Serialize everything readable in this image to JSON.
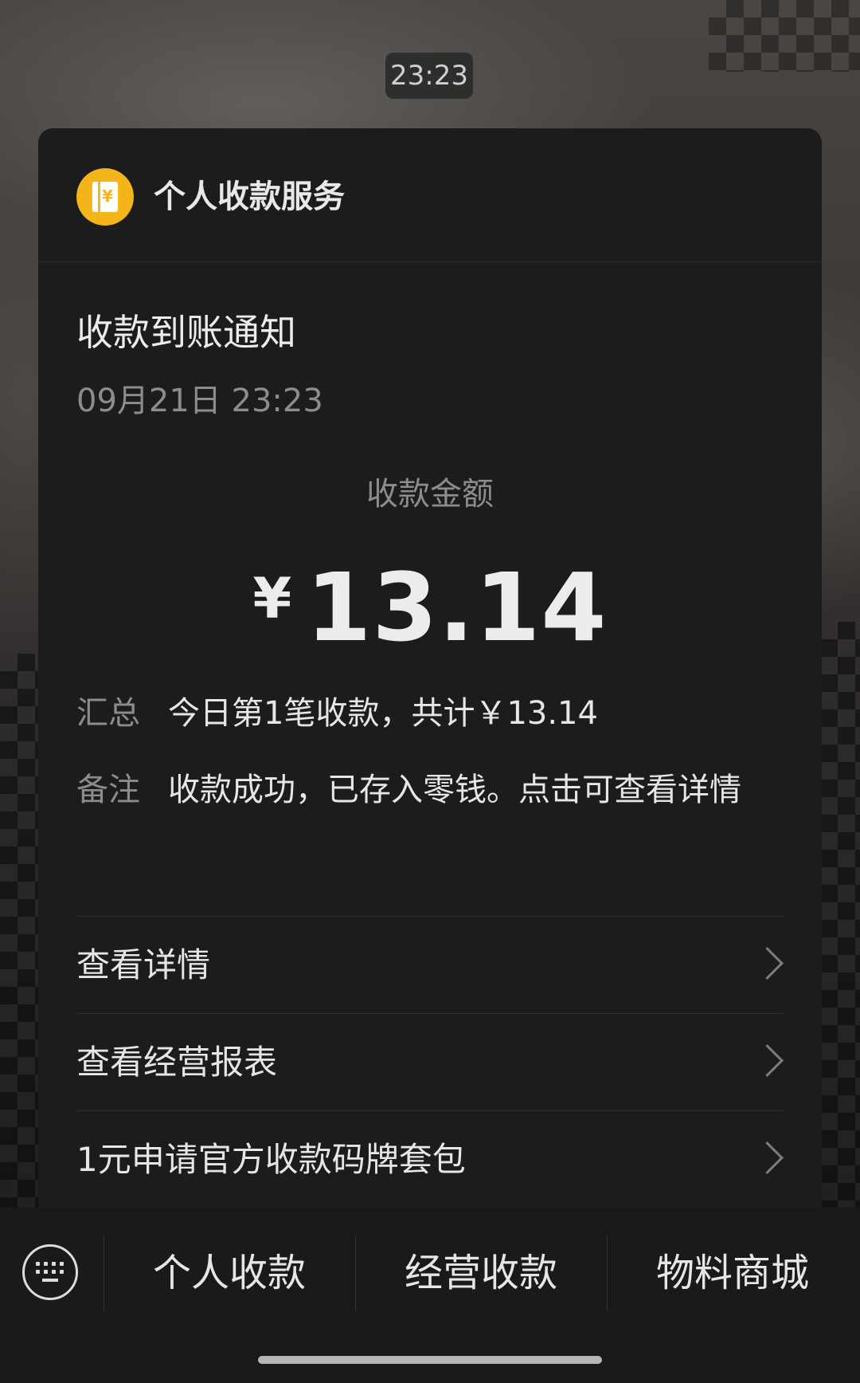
{
  "chat": {
    "timestamp": "23:23"
  },
  "card": {
    "service_name": "个人收款服务",
    "logo_icon": "wallet-yen-icon",
    "logo_symbol": "¥",
    "brand_color": "#f3b51a",
    "title": "收款到账通知",
    "datetime": "09月21日 23:23",
    "amount_label": "收款金额",
    "amount_currency": "¥",
    "amount_value": "13.14",
    "summary_label": "汇总",
    "summary_value": "今日第1笔收款，共计￥13.14",
    "note_label": "备注",
    "note_value": "收款成功，已存入零钱。点击可查看详情",
    "links": [
      {
        "label": "查看详情"
      },
      {
        "label": "查看经营报表"
      },
      {
        "label": "1元申请官方收款码牌套包"
      }
    ]
  },
  "bottom_menu": {
    "keyboard_icon": "keyboard-icon",
    "items": [
      {
        "label": "个人收款"
      },
      {
        "label": "经营收款"
      },
      {
        "label": "物料商城"
      }
    ]
  }
}
